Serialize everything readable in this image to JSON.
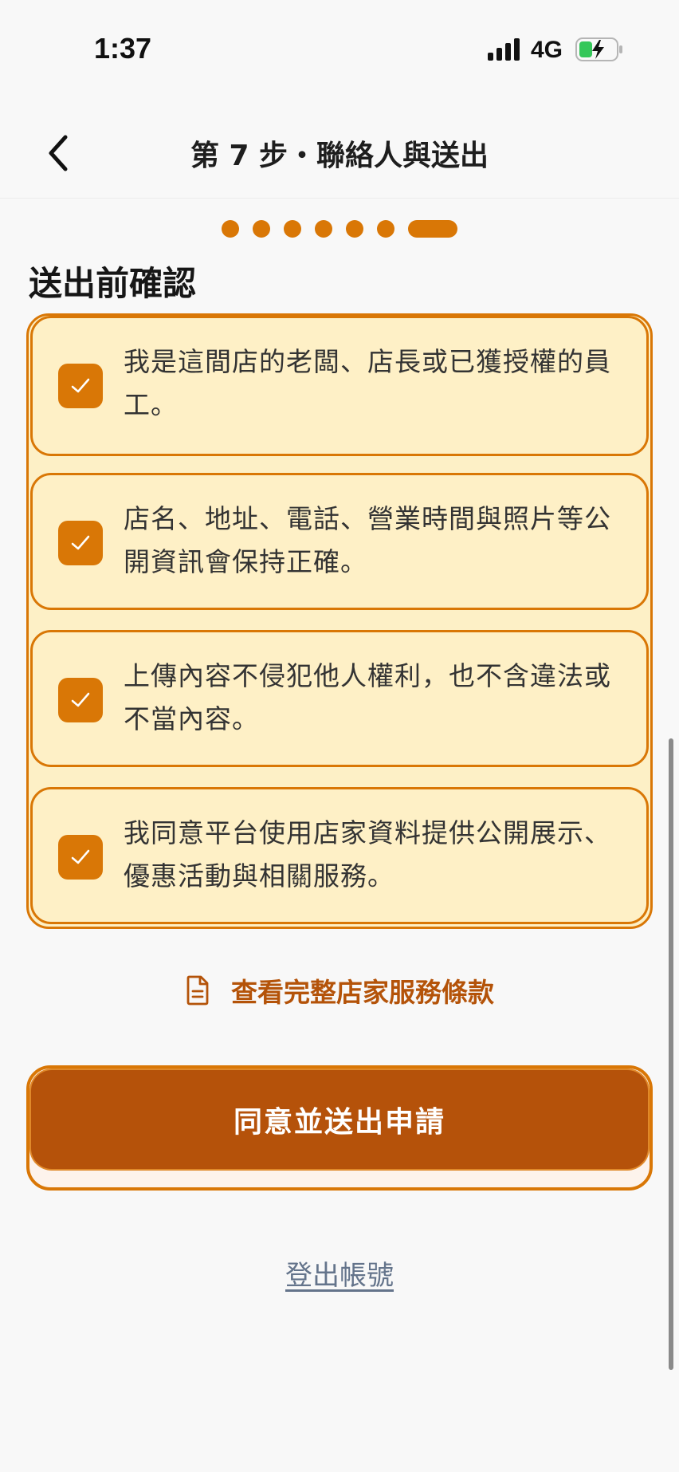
{
  "status_bar": {
    "time": "1:37",
    "network": "4G",
    "signal_icon": "signal-bars-icon",
    "battery_icon": "battery-charging-icon"
  },
  "header": {
    "back_icon": "chevron-left-icon",
    "title": "第 7 步・聯絡人與送出"
  },
  "progress": {
    "total_steps": 7,
    "current_step": 7
  },
  "section_title": "送出前確認",
  "confirmations": [
    {
      "checked": true,
      "text": "我是這間店的老闆、店長或已獲授權的員工。"
    },
    {
      "checked": true,
      "text": "店名、地址、電話、營業時間與照片等公開資訊會保持正確。"
    },
    {
      "checked": true,
      "text": "上傳內容不侵犯他人權利，也不含違法或不當內容。"
    },
    {
      "checked": true,
      "text": "我同意平台使用店家資料提供公開展示、優惠活動與相關服務。"
    }
  ],
  "terms_link": {
    "icon": "document-icon",
    "label": "查看完整店家服務條款"
  },
  "submit_button": "同意並送出申請",
  "logout_link": "登出帳號",
  "colors": {
    "accent": "#d97706",
    "button": "#b5520a",
    "card_bg": "#fef0c6",
    "link": "#b45309",
    "muted": "#64748b"
  }
}
